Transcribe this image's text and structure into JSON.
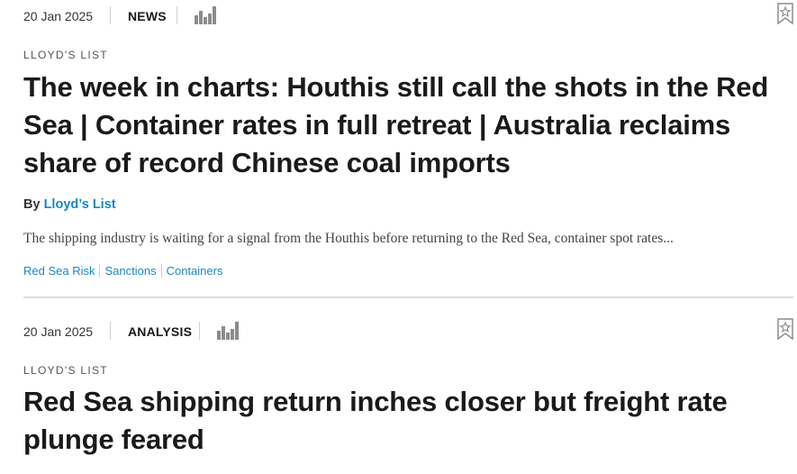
{
  "articles": [
    {
      "date": "20 Jan 2025",
      "type": "NEWS",
      "source": "LLOYD'S LIST",
      "headline": "The week in charts: Houthis still call the shots in the Red Sea | Container rates in full retreat | Australia reclaims share of record Chinese coal imports",
      "byline_prefix": "By ",
      "author": "Lloyd’s List",
      "summary": "The shipping industry is waiting for a signal from the Houthis before returning to the Red Sea, container spot rates...",
      "tags": [
        "Red Sea Risk",
        "Sanctions",
        "Containers"
      ],
      "icons": {
        "chart": "bar-chart-icon",
        "bookmark": "bookmark-star-icon"
      }
    },
    {
      "date": "20 Jan 2025",
      "type": "ANALYSIS",
      "source": "LLOYD'S LIST",
      "headline": "Red Sea shipping return inches closer but freight rate plunge feared",
      "icons": {
        "chart": "bar-chart-icon",
        "bookmark": "bookmark-star-icon"
      }
    }
  ],
  "colors": {
    "link": "#1a87c2",
    "divider": "#dcdcdc",
    "icon_gray": "#8c8c8c"
  }
}
